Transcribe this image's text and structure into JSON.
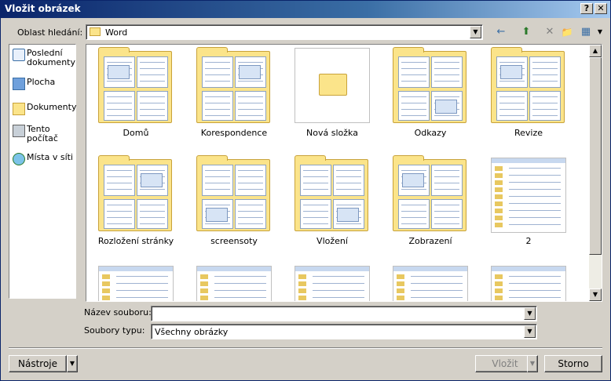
{
  "window": {
    "title": "Vložit obrázek",
    "help": "?",
    "close": "✕"
  },
  "look_in": {
    "label": "Oblast hledání:",
    "value": "Word"
  },
  "toolbar": {
    "back": "←",
    "up": "⬆",
    "delete": "✕",
    "new_folder": "📁",
    "views": "▦"
  },
  "places": [
    {
      "label": "Poslední dokumenty",
      "icon": "recent-icon"
    },
    {
      "label": "Plocha",
      "icon": "desktop-icon"
    },
    {
      "label": "Dokumenty",
      "icon": "documents-icon"
    },
    {
      "label": "Tento počítač",
      "icon": "computer-icon"
    },
    {
      "label": "Místa v síti",
      "icon": "network-icon"
    }
  ],
  "items": [
    {
      "name": "Domů",
      "kind": "folder"
    },
    {
      "name": "Korespondence",
      "kind": "folder"
    },
    {
      "name": "Nová složka",
      "kind": "empty-folder"
    },
    {
      "name": "Odkazy",
      "kind": "folder"
    },
    {
      "name": "Revize",
      "kind": "folder"
    },
    {
      "name": "Rozložení stránky",
      "kind": "folder"
    },
    {
      "name": "screensoty",
      "kind": "folder"
    },
    {
      "name": "Vložení",
      "kind": "folder"
    },
    {
      "name": "Zobrazení",
      "kind": "folder"
    },
    {
      "name": "2",
      "kind": "image"
    },
    {
      "name": "",
      "kind": "image"
    },
    {
      "name": "",
      "kind": "image"
    },
    {
      "name": "",
      "kind": "image"
    },
    {
      "name": "",
      "kind": "image"
    },
    {
      "name": "",
      "kind": "image"
    }
  ],
  "file_name": {
    "label": "Název souboru:",
    "value": ""
  },
  "file_type": {
    "label": "Soubory typu:",
    "value": "Všechny obrázky"
  },
  "buttons": {
    "tools": "Nástroje",
    "insert": "Vložit",
    "cancel": "Storno"
  },
  "colors": {
    "titlebar": "#0a246a",
    "folder": "#fbe48a",
    "face": "#d4d0c8"
  }
}
